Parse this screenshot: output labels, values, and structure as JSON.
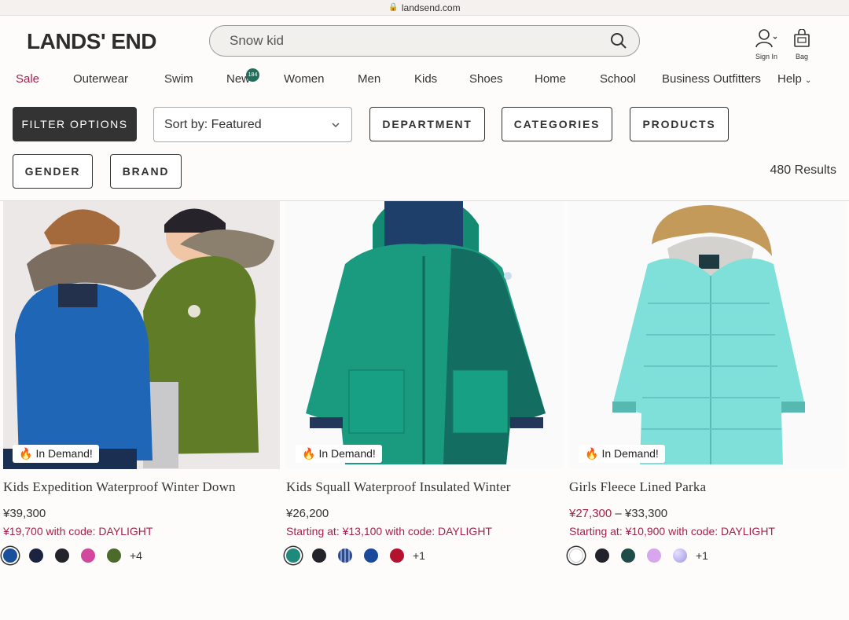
{
  "browser": {
    "url": "landsend.com"
  },
  "header": {
    "logo": "LANDS' END",
    "search": {
      "value": "Snow kid"
    },
    "account_label": "Sign In",
    "bag_label": "Bag"
  },
  "nav": {
    "items": [
      "Sale",
      "Outerwear",
      "Swim",
      "New",
      "Women",
      "Men",
      "Kids",
      "Shoes",
      "Home",
      "School",
      "Business Outfitters",
      "Help"
    ],
    "new_badge": "184"
  },
  "filters": {
    "filter_options": "FILTER OPTIONS",
    "sort_label": "Sort by: Featured",
    "department": "DEPARTMENT",
    "categories": "CATEGORIES",
    "products": "PRODUCTS",
    "gender": "GENDER",
    "brand": "BRAND",
    "results": "480 Results"
  },
  "products": [
    {
      "badge": "In Demand!",
      "name": "Kids Expedition Waterproof Winter Down",
      "price": "¥39,300",
      "price_sale": "",
      "price_sep": "",
      "promo": "¥19,700 with code: DAYLIGHT",
      "swatches": [
        "#1a4f9c",
        "#1c2340",
        "#23242b",
        "#d0479b",
        "#4c6a2b"
      ],
      "more": "+4"
    },
    {
      "badge": "In Demand!",
      "name": "Kids Squall Waterproof Insulated Winter",
      "price": "¥26,200",
      "price_sale": "",
      "price_sep": "",
      "promo": "Starting at: ¥13,100 with code: DAYLIGHT",
      "swatches": [
        "#1f8a7c",
        "#23242b",
        "#2e4a8c",
        "#1c4a9a",
        "#b3132e"
      ],
      "more": "+1"
    },
    {
      "badge": "In Demand!",
      "name": "Girls Fleece Lined Parka",
      "price_sale": "¥27,300",
      "price_sep": " – ",
      "price": "¥33,300",
      "promo": "Starting at: ¥10,900 with code: DAYLIGHT",
      "swatches": [
        "#ffffff",
        "#23242b",
        "#1e4d49",
        "#d8a6ee",
        "#b9b3ef"
      ],
      "more": "+1"
    }
  ]
}
